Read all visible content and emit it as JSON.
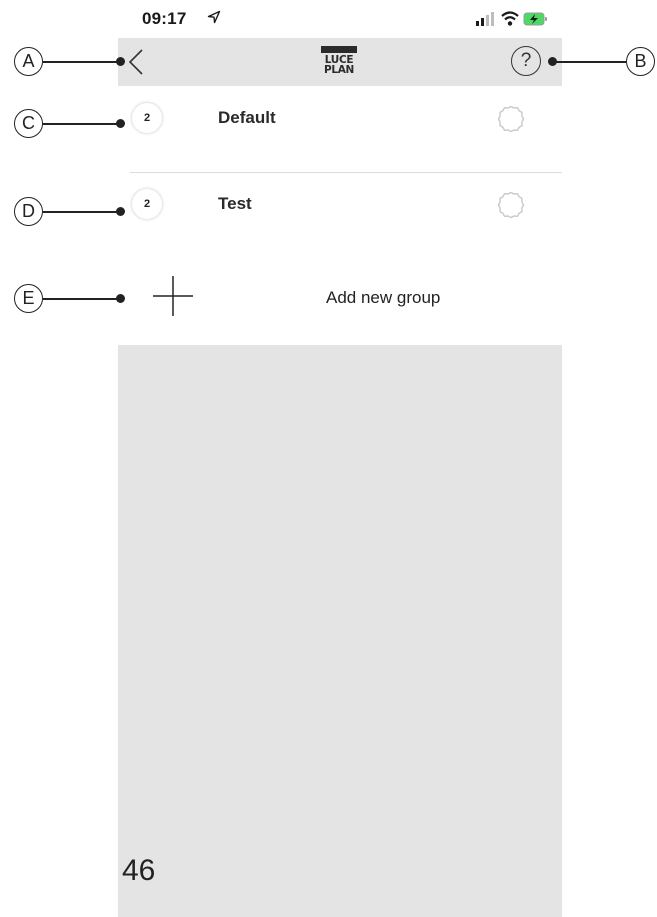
{
  "status_bar": {
    "time": "09:17",
    "location_icon": "location-arrow-icon",
    "signal_icon": "signal-bars-icon",
    "wifi_icon": "wifi-icon",
    "battery_icon": "battery-charging-icon"
  },
  "nav": {
    "back_icon": "chevron-left-icon",
    "logo_line1": "LUCE",
    "logo_line2": "PLAN",
    "help_label": "?"
  },
  "groups": [
    {
      "count": "2",
      "name": "Default",
      "settings_icon": "gear-icon"
    },
    {
      "count": "2",
      "name": "Test",
      "settings_icon": "gear-icon"
    }
  ],
  "add_group": {
    "icon": "plus-icon",
    "label": "Add new group"
  },
  "callouts": [
    "A",
    "B",
    "C",
    "D",
    "E"
  ],
  "page_number": "46",
  "colors": {
    "nav_background": "#e4e4e4",
    "empty_background": "#e4e4e4",
    "divider": "#dcdcdc",
    "text": "#2a2a2a",
    "battery": "#4cd964"
  }
}
